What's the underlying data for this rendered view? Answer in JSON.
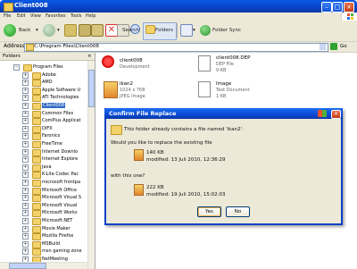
{
  "window": {
    "title": "Client008"
  },
  "menu": [
    "File",
    "Edit",
    "View",
    "Favorites",
    "Tools",
    "Help"
  ],
  "toolbar": {
    "back_label": "Back",
    "search_label": "Search",
    "folders_label": "Folders",
    "folder_sync_label": "Folder Sync"
  },
  "address": {
    "label": "Address",
    "value": "C:\\Program Files\\Client008",
    "go_label": "Go"
  },
  "folders_pane": {
    "title": "Folders",
    "close": "×",
    "items": [
      "Program Files",
      "Adobe",
      "AMD",
      "Apple Software U",
      "ATI Technologies",
      "Client008",
      "Common Files",
      "ComPlus Applicat",
      "DIFX",
      "Faronics",
      "FreeTime",
      "Internet Downlo",
      "Internet Explore",
      "Java",
      "K-Lite Codec Pac",
      "microsoft frontpa",
      "Microsoft Office",
      "Microsoft Visual S",
      "Microsoft Visual",
      "Microsoft Works",
      "Microsoft.NET",
      "Movie Maker",
      "Mozilla Firefox",
      "MSBuild",
      "msn gaming zone",
      "NetMeeting"
    ]
  },
  "files": [
    {
      "name": "client008",
      "sub": "Development",
      "icon": "client-app-icon"
    },
    {
      "name": "client008.DEP",
      "sub": "DEP File",
      "sub2": "9 KB",
      "icon": "file-icon"
    },
    {
      "name": "ikan2",
      "sub": "1024 x 768",
      "sub2": "JPEG Image",
      "icon": "jpeg-image-icon"
    },
    {
      "name": "Image",
      "sub": "Text Document",
      "sub2": "1 KB",
      "icon": "text-document-icon"
    }
  ],
  "dialog": {
    "title": "Confirm File Replace",
    "message": "This folder already contains a file named 'ikan2'.",
    "question": "Would you like to replace the existing file",
    "existing": {
      "size": "140 KB",
      "modified": "modified: 13 Juli 2010, 12:36:29"
    },
    "with_label": "with this one?",
    "new": {
      "size": "222 KB",
      "modified": "modified: 19 Juli 2010, 15:02:03"
    },
    "yes_label": "Yes",
    "no_label": "No"
  },
  "colors": {
    "titlebar": "#0a4ad4",
    "selection": "#316ac5",
    "chrome": "#ece9d8"
  }
}
